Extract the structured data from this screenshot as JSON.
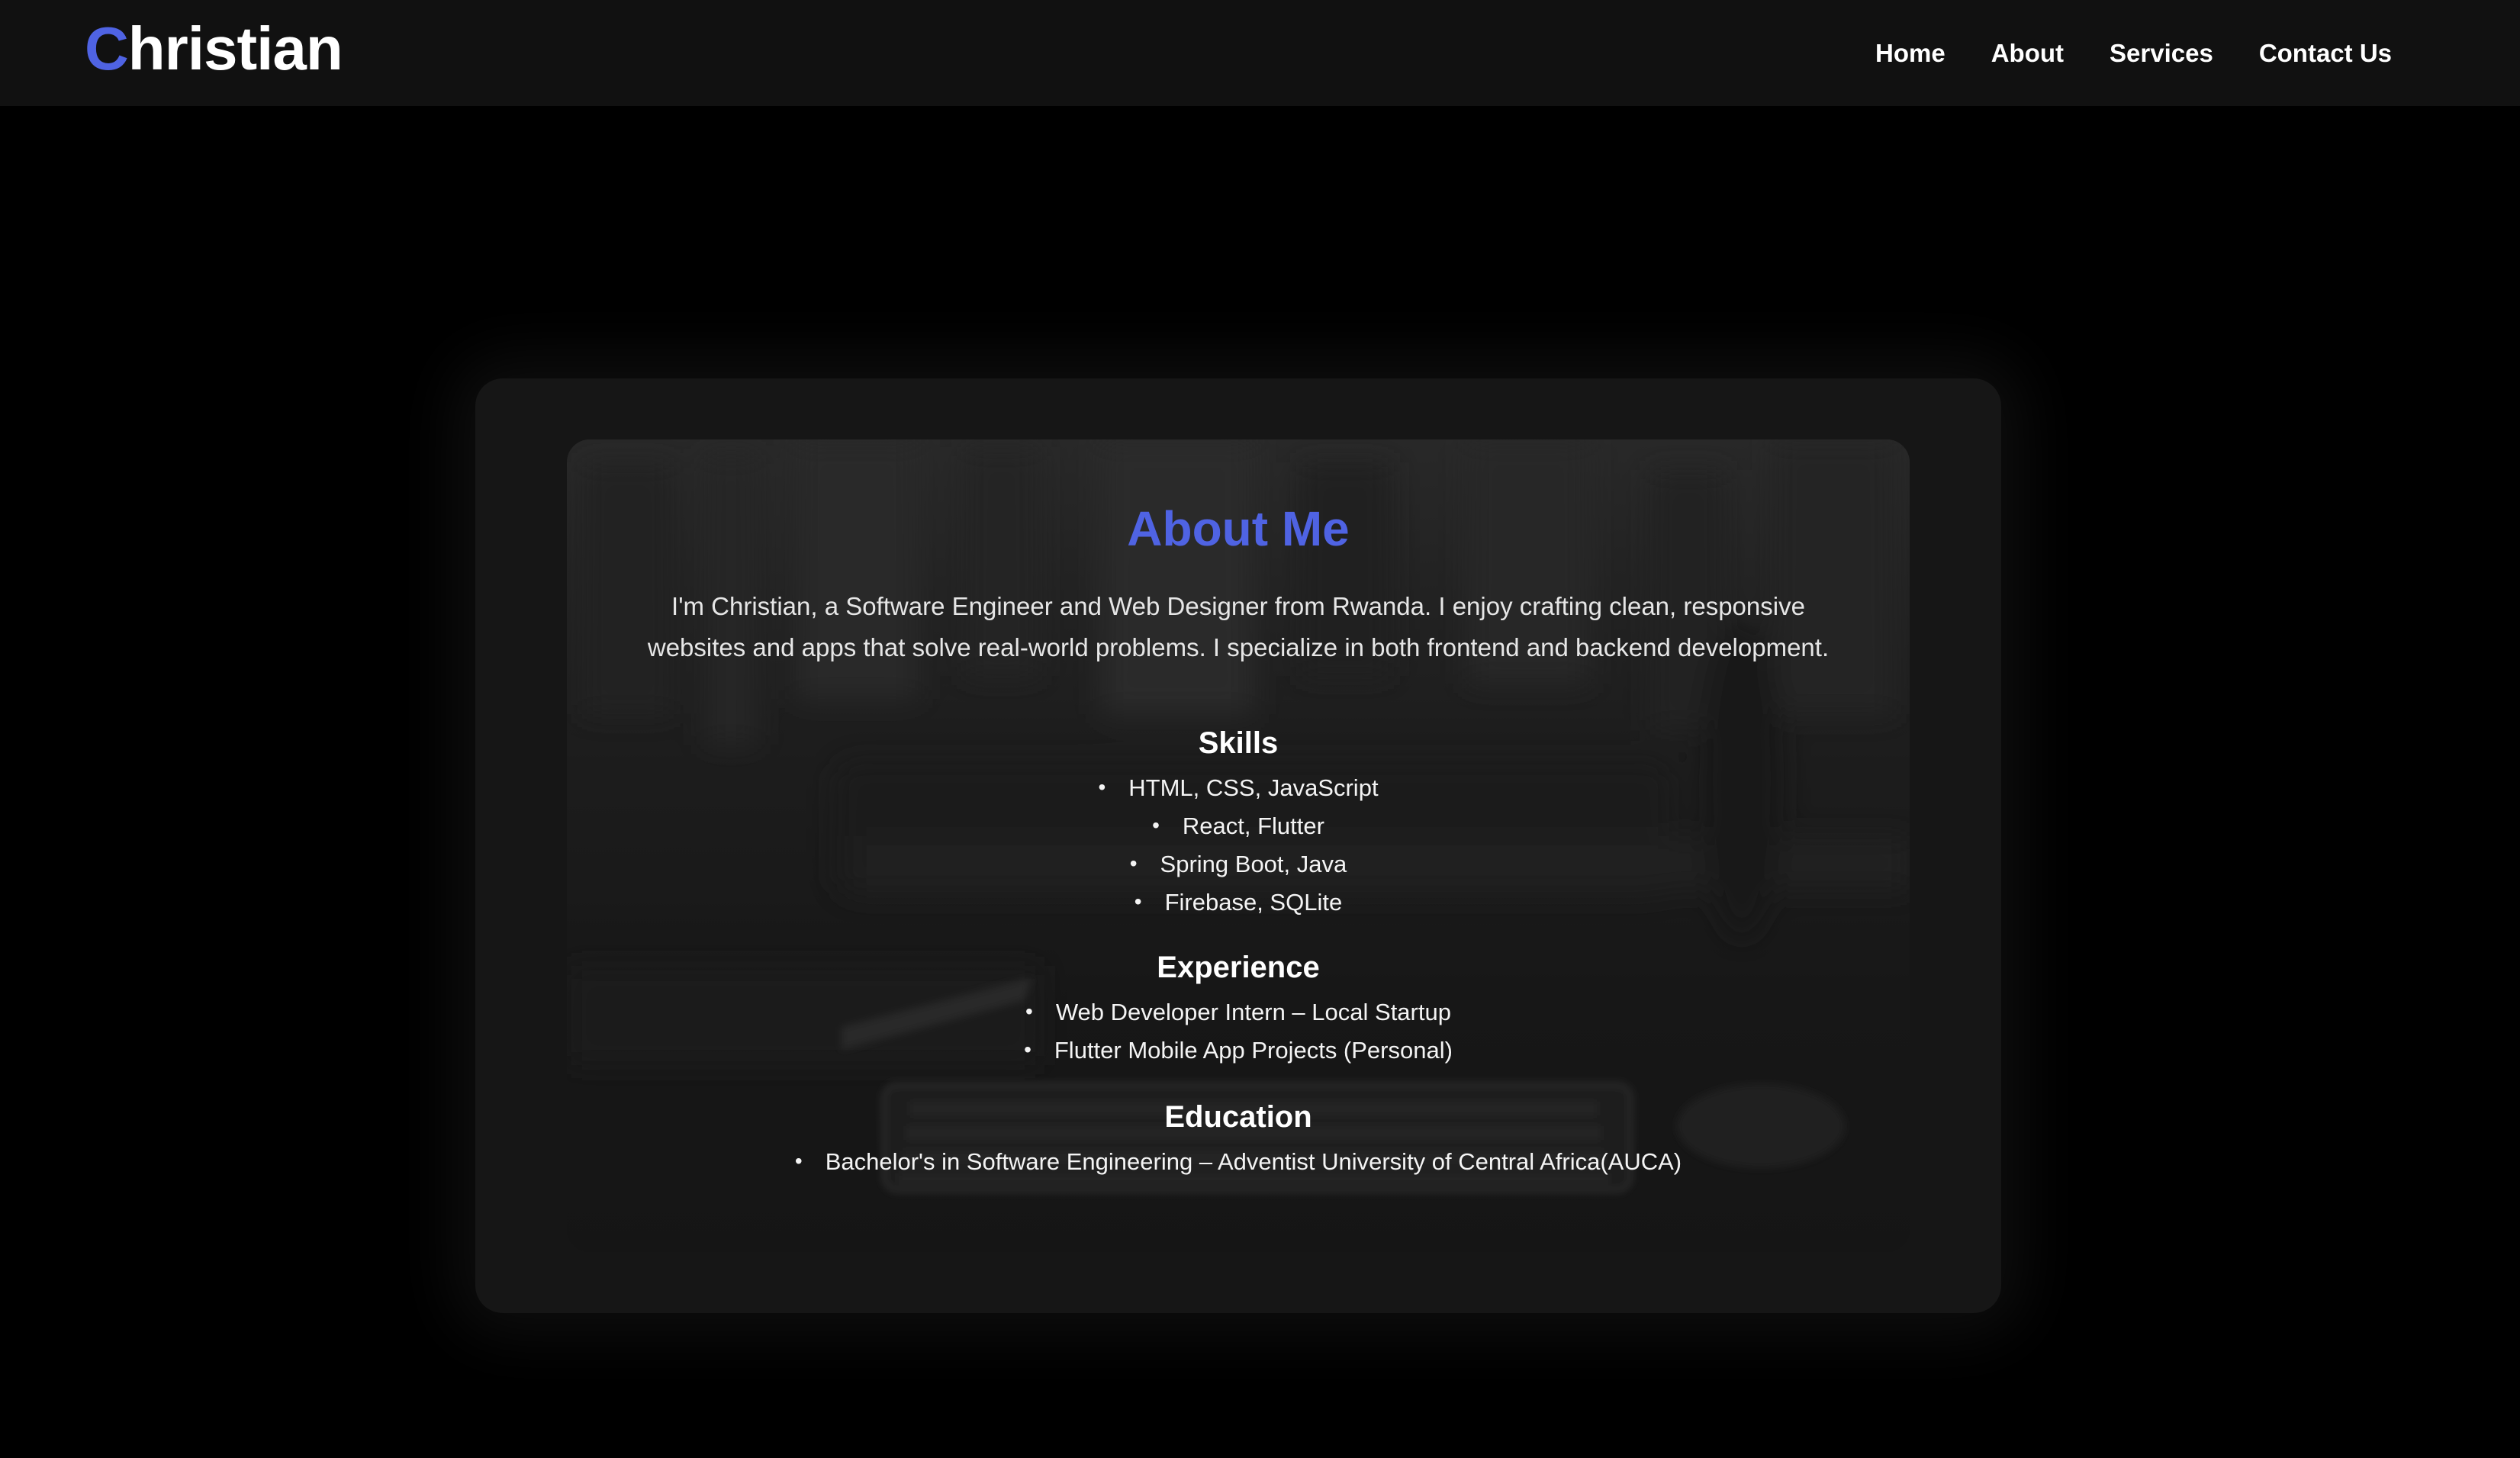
{
  "header": {
    "logo_first_letter": "C",
    "logo_rest": "hristian",
    "nav": [
      {
        "label": "Home"
      },
      {
        "label": "About"
      },
      {
        "label": "Services"
      },
      {
        "label": "Contact Us"
      }
    ]
  },
  "about": {
    "title": "About Me",
    "intro": "I'm Christian, a Software Engineer and Web Designer from Rwanda. I enjoy crafting clean, responsive websites and apps that solve real-world problems. I specialize in both frontend and backend development.",
    "skills": {
      "title": "Skills",
      "items": [
        "HTML, CSS, JavaScript",
        "React, Flutter",
        "Spring Boot, Java",
        "Firebase, SQLite"
      ]
    },
    "experience": {
      "title": "Experience",
      "items": [
        "Web Developer Intern – Local Startup",
        "Flutter Mobile App Projects (Personal)"
      ]
    },
    "education": {
      "title": "Education",
      "items": [
        "Bachelor's in Software Engineering – Adventist University of Central Africa(AUCA)"
      ]
    }
  },
  "colors": {
    "accent": "#4f63e3",
    "page_background": "#000000",
    "navbar_background": "#111111",
    "card_background": "#161616"
  }
}
